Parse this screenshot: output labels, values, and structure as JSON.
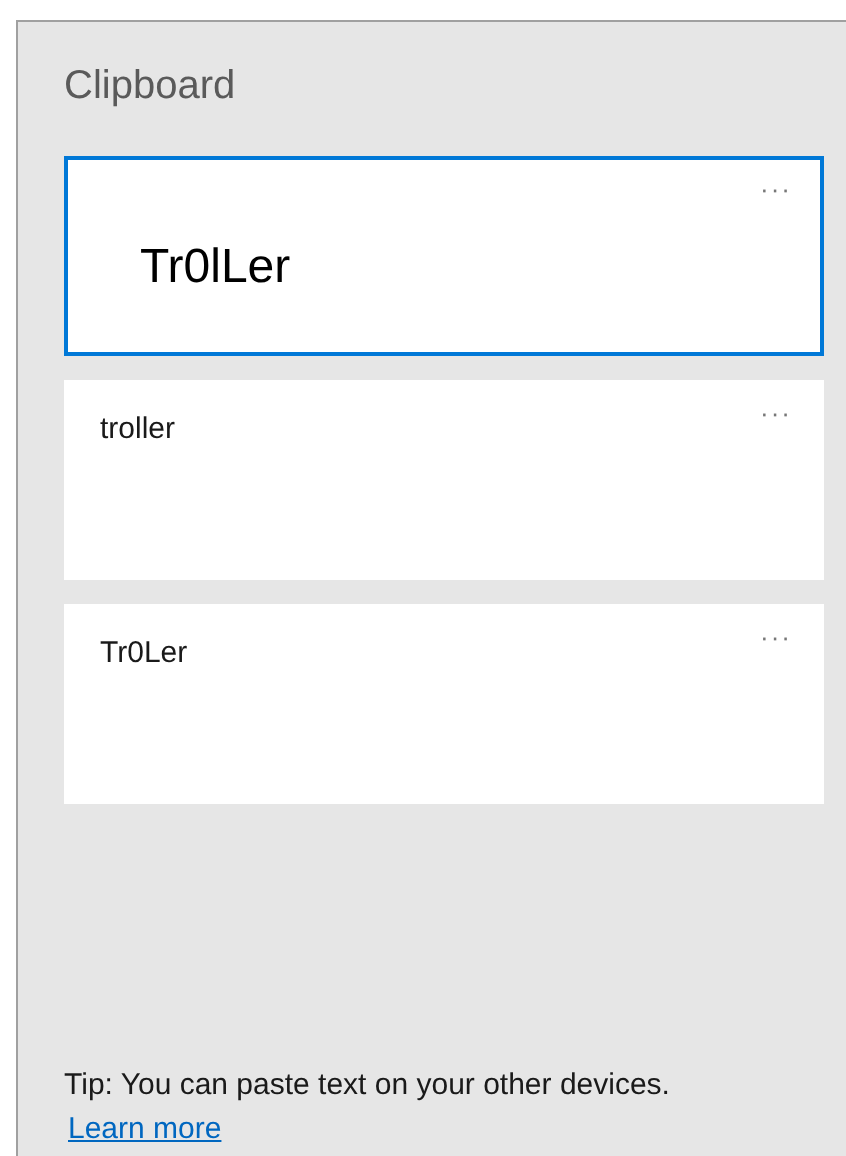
{
  "panel": {
    "title": "Clipboard"
  },
  "items": [
    {
      "kind": "image",
      "text": "Tr0lLer",
      "selected": true,
      "menu": "···"
    },
    {
      "kind": "text",
      "text": "troller",
      "selected": false,
      "menu": "···"
    },
    {
      "kind": "text",
      "text": "Tr0Ler",
      "selected": false,
      "menu": "···"
    }
  ],
  "footer": {
    "tip": "Tip: You can paste text on your other devices.",
    "link": "Learn more"
  }
}
